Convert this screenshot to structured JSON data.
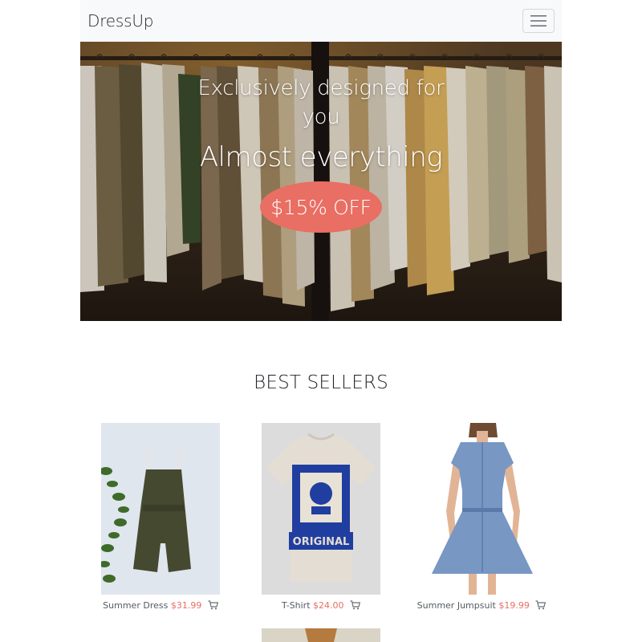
{
  "navbar": {
    "brand": "DressUp",
    "menu_icon": "hamburger-menu-icon"
  },
  "hero": {
    "line1": "Exclusively designed for",
    "line1b": "you",
    "line2": "Almost everything",
    "cta_label": "$15% OFF",
    "image": "clothing-rack-photo"
  },
  "best_sellers": {
    "title": "BEST SELLERS",
    "products": [
      {
        "name": "Summer Dress",
        "price": "$31.99",
        "image": "olive-romper-photo",
        "cart_icon": "cart-icon"
      },
      {
        "name": "T-Shirt",
        "price": "$24.00",
        "image": "original-tshirt-photo",
        "cart_icon": "cart-icon"
      },
      {
        "name": "Summer Jumpsuit",
        "price": "$19.99",
        "image": "denim-dress-photo",
        "cart_icon": "cart-icon"
      }
    ]
  },
  "colors": {
    "accent": "#e96e63",
    "navbar_bg": "#f8f9fa",
    "text_dark": "#212529",
    "text_muted": "#555b61"
  }
}
